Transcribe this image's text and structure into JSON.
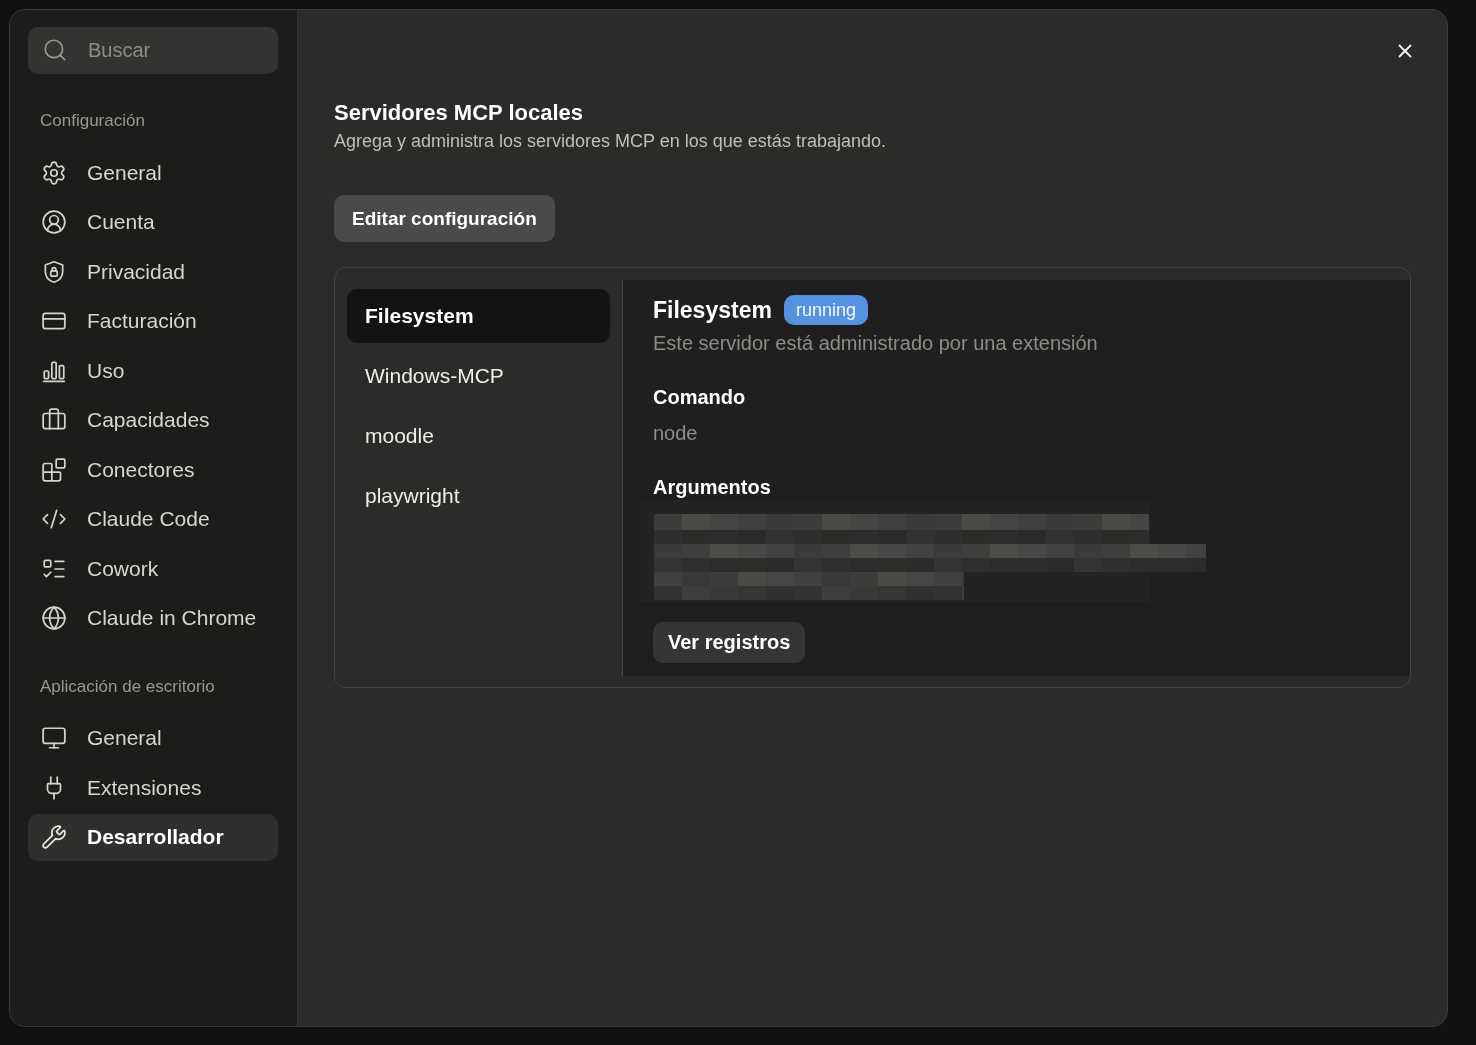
{
  "sidebar": {
    "search": {
      "placeholder": "Buscar"
    },
    "sections": [
      {
        "title": "Configuración",
        "items": [
          {
            "label": "General",
            "selected": false
          },
          {
            "label": "Cuenta",
            "selected": false
          },
          {
            "label": "Privacidad",
            "selected": false
          },
          {
            "label": "Facturación",
            "selected": false
          },
          {
            "label": "Uso",
            "selected": false
          },
          {
            "label": "Capacidades",
            "selected": false
          },
          {
            "label": "Conectores",
            "selected": false
          },
          {
            "label": "Claude Code",
            "selected": false
          },
          {
            "label": "Cowork",
            "selected": false
          },
          {
            "label": "Claude in Chrome",
            "selected": false
          }
        ]
      },
      {
        "title": "Aplicación de escritorio",
        "items": [
          {
            "label": "General",
            "selected": false
          },
          {
            "label": "Extensiones",
            "selected": false
          },
          {
            "label": "Desarrollador",
            "selected": true
          }
        ]
      }
    ]
  },
  "main": {
    "title": "Servidores MCP locales",
    "subtitle": "Agrega y administra los servidores MCP en los que estás trabajando.",
    "edit_button": "Editar configuración",
    "servers": [
      {
        "name": "Filesystem",
        "selected": true
      },
      {
        "name": "Windows-MCP",
        "selected": false
      },
      {
        "name": "moodle",
        "selected": false
      },
      {
        "name": "playwright",
        "selected": false
      }
    ],
    "detail": {
      "name": "Filesystem",
      "status": "running",
      "description": "Este servidor está administrado por una extensión",
      "command_label": "Comando",
      "command": "node",
      "arguments_label": "Argumentos",
      "logs_button": "Ver registros"
    }
  }
}
